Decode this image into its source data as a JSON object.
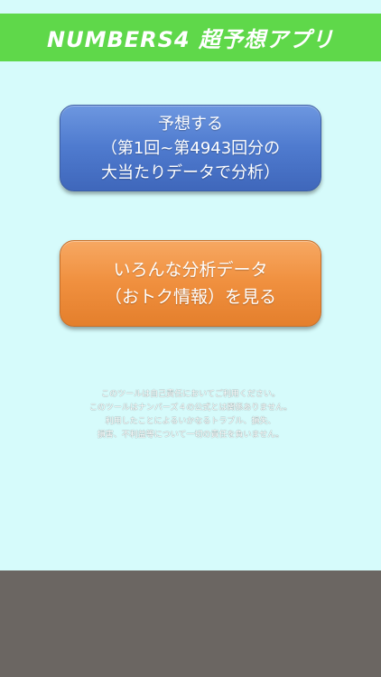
{
  "header": {
    "title": "NUMBERS4 超予想アプリ",
    "background": "#5fd84a"
  },
  "buttons": {
    "predict": {
      "line1": "予想する",
      "line2": "（第1回~第4943回分の",
      "line3": "大当たりデータで分析）",
      "color": "#4f7bcf"
    },
    "analysis": {
      "line1": "いろんな分析データ",
      "line2": "（おトク情報）を見る",
      "color": "#f0903f"
    }
  },
  "disclaimer": {
    "lines": [
      "このツールは自己責任においてご利用ください。",
      "このツールはナンバーズ４の公式とは関係ありません。",
      "利用したことによるいかなるトラブル、損失、",
      "損害、不利益等について一切の責任を負いません。"
    ]
  },
  "colors": {
    "background": "#d6fbfb",
    "footer": "#6b6662"
  }
}
